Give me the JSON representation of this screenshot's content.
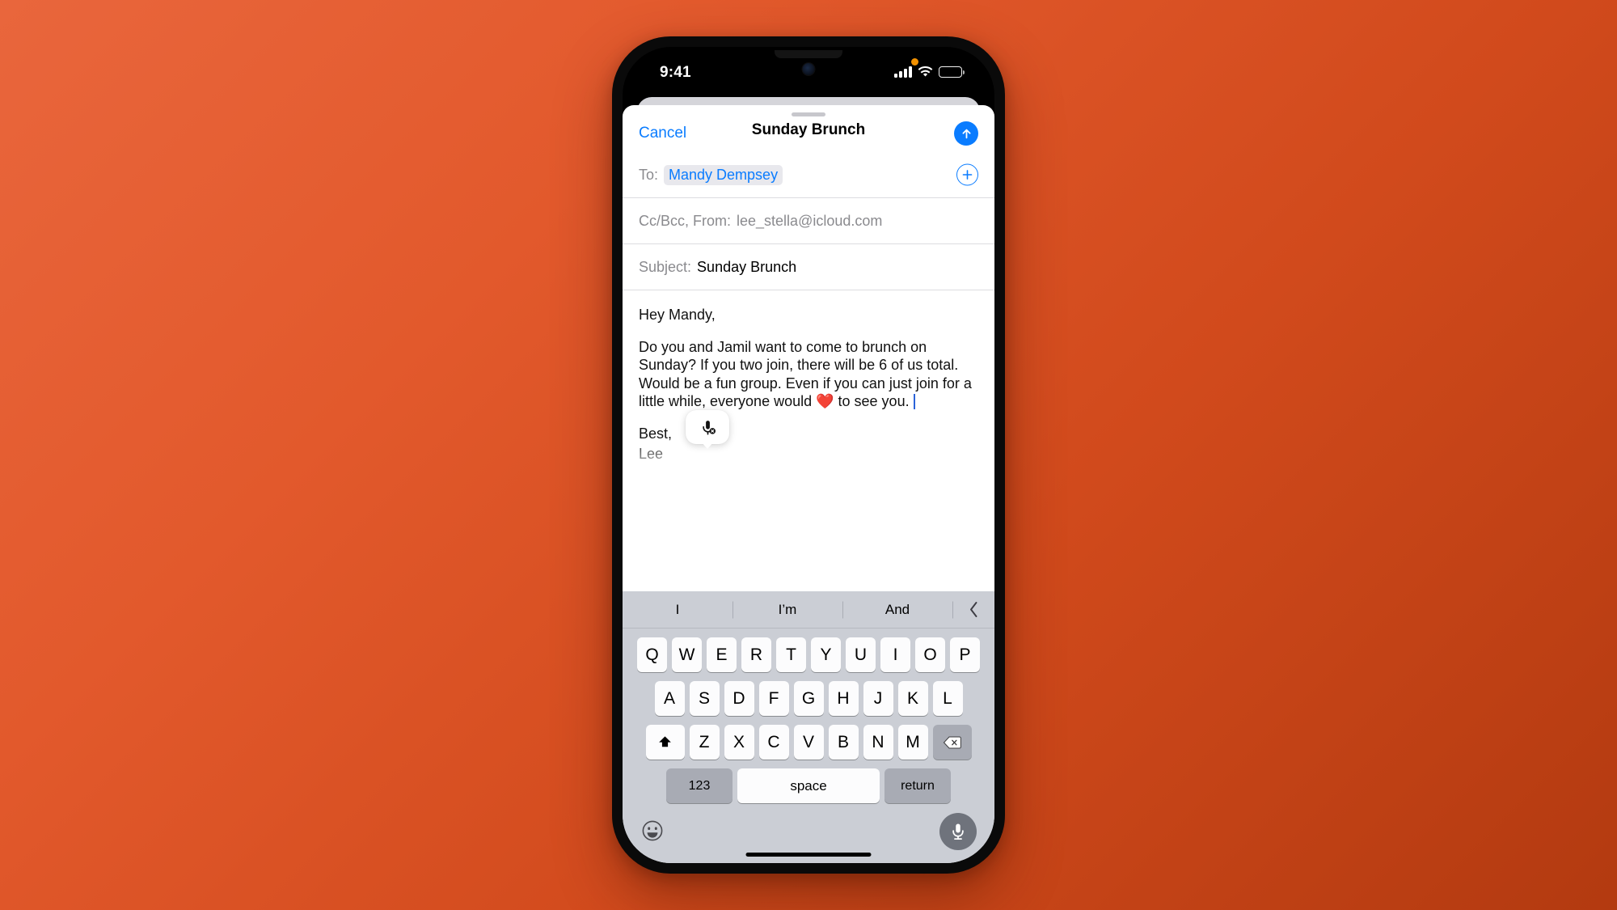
{
  "background": {
    "gradient_from": "#e9663c",
    "gradient_to": "#b33a10"
  },
  "status_bar": {
    "time": "9:41",
    "signal_icon": "cellular-bars-icon",
    "wifi_icon": "wifi-icon",
    "battery_icon": "battery-icon",
    "mic_in_use_indicator": "orange-dot-microphone-in-use"
  },
  "compose": {
    "cancel_label": "Cancel",
    "title": "Sunday Brunch",
    "send_icon": "arrow-up-circle-icon",
    "add_contact_icon": "plus-circle-icon",
    "to": {
      "label": "To:",
      "recipient": "Mandy Dempsey"
    },
    "cc_bcc_from": {
      "label": "Cc/Bcc, From:",
      "value": "lee_stella@icloud.com"
    },
    "subject": {
      "label": "Subject:",
      "value": "Sunday Brunch"
    },
    "body": {
      "greeting": "Hey Mandy,",
      "paragraph": "Do you and Jamil want to come to brunch on Sunday? If you two join, there will be 6 of us total. Would be a fun group. Even if you can just join for a little while, everyone would ❤️ to see you.",
      "signoff_line1": "Best,",
      "signoff_line2": "Lee"
    }
  },
  "dictation_popup": {
    "icon": "microphone-slash-icon"
  },
  "keyboard": {
    "predictions": [
      "I",
      "I’m",
      "And"
    ],
    "collapse_icon": "chevron-left-icon",
    "row1": [
      "Q",
      "W",
      "E",
      "R",
      "T",
      "Y",
      "U",
      "I",
      "O",
      "P"
    ],
    "row2": [
      "A",
      "S",
      "D",
      "F",
      "G",
      "H",
      "J",
      "K",
      "L"
    ],
    "row3": [
      "Z",
      "X",
      "C",
      "V",
      "B",
      "N",
      "M"
    ],
    "shift_icon": "shift-arrow-up-icon",
    "backspace_icon": "delete-backward-icon",
    "numbers_label": "123",
    "space_label": "space",
    "return_label": "return",
    "emoji_icon": "emoji-smiley-icon",
    "dictation_icon": "microphone-icon"
  },
  "colors": {
    "accent_blue": "#0a7cff",
    "keyboard_background": "#cbced5",
    "key_white": "#fcfcfd",
    "key_grey": "#a8abb4"
  }
}
